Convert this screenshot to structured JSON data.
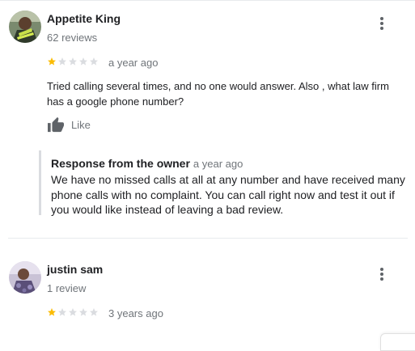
{
  "colors": {
    "star_filled": "#fbbc04",
    "star_empty": "#dadce0",
    "secondary_text": "#70757a"
  },
  "reviews": [
    {
      "reviewer_name": "Appetite King",
      "reviewer_meta": "62 reviews",
      "rating": 1,
      "rating_max": 5,
      "time": "a year ago",
      "text": "Tried calling several times, and no one would answer. Also , what law firm has a google phone number?",
      "like_label": "Like",
      "owner_response": {
        "title": "Response from the owner",
        "time": "a year ago",
        "text": "We have no missed calls at all at any number and have received many phone calls with no complaint. You can call right now and test it out if you would like instead of leaving a bad review."
      }
    },
    {
      "reviewer_name": "justin sam",
      "reviewer_meta": "1 review",
      "rating": 1,
      "rating_max": 5,
      "time": "3 years ago"
    }
  ],
  "icons": {
    "menu": "more-vert-icon",
    "like": "thumb-up-icon",
    "star": "star-icon"
  }
}
